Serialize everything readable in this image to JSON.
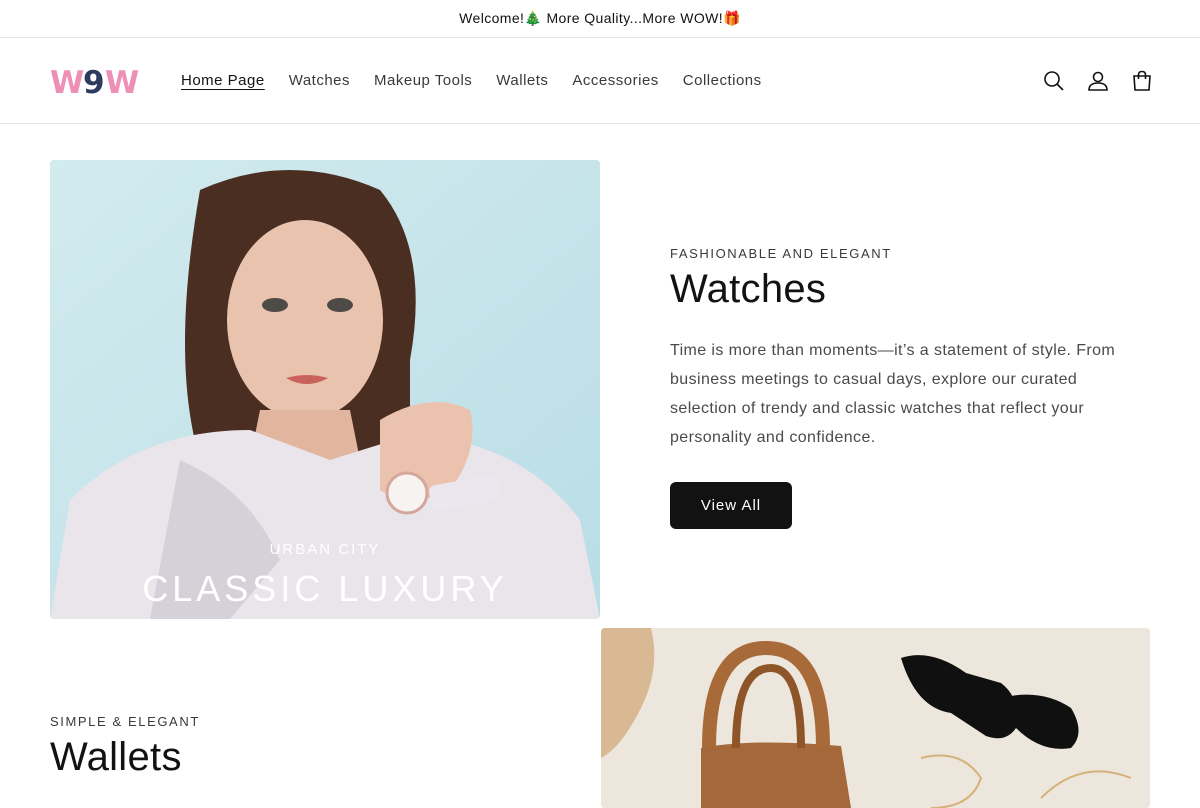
{
  "announcement": {
    "text": "Welcome!🎄 More Quality...More WOW!🎁"
  },
  "logo": {
    "text": "W9W",
    "colors": {
      "w": "#ee8fb6",
      "nine": "#2e3b5e"
    }
  },
  "nav": [
    {
      "label": "Home Page",
      "active": true
    },
    {
      "label": "Watches"
    },
    {
      "label": "Makeup Tools"
    },
    {
      "label": "Wallets"
    },
    {
      "label": "Accessories"
    },
    {
      "label": "Collections"
    }
  ],
  "header_icons": [
    "search-icon",
    "account-icon",
    "cart-icon"
  ],
  "section_watches": {
    "image": {
      "subtitle": "URBAN CITY",
      "title": "CLASSIC LUXURY"
    },
    "eyebrow": "FASHIONABLE AND ELEGANT",
    "heading": "Watches",
    "description": "Time is more than moments—it’s a statement of style. From business meetings to casual days, explore our curated selection of trendy and classic watches that reflect your personality and confidence.",
    "button": "View All"
  },
  "section_wallets": {
    "eyebrow": "SIMPLE & ELEGANT",
    "heading": "Wallets"
  },
  "colors": {
    "primary_button": "#121212",
    "text": "#121212",
    "border": "#e6e6e6"
  }
}
